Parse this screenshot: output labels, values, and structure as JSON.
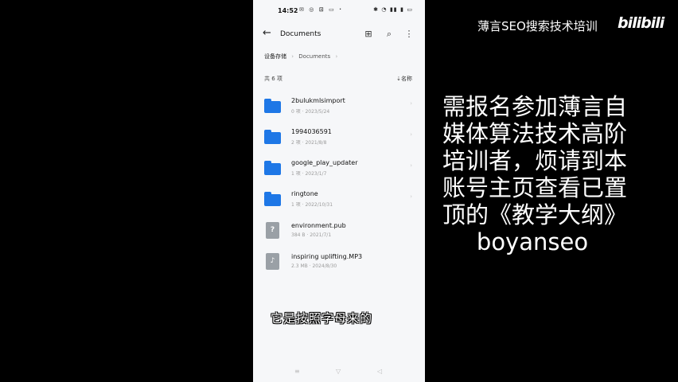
{
  "status": {
    "time": "14:52",
    "left_icons": "✉ ◎ ⊡ ▭ ·",
    "right_icons": "✱ ◔ ▮▮ ▮ ▭"
  },
  "appbar": {
    "title": "Documents"
  },
  "breadcrumb": {
    "root": "设备存储",
    "sep": "›",
    "current": "Documents",
    "tail": "›"
  },
  "list_header": {
    "count": "共 6 项",
    "sort": "⇣名称"
  },
  "files": [
    {
      "name": "2bulukmlsimport",
      "meta": "0 项  ·  2023/5/24",
      "type": "folder"
    },
    {
      "name": "1994036591",
      "meta": "2 项  ·  2021/8/8",
      "type": "folder"
    },
    {
      "name": "google_play_updater",
      "meta": "1 项  ·  2023/1/7",
      "type": "folder"
    },
    {
      "name": "ringtone",
      "meta": "1 项  ·  2022/10/31",
      "type": "folder"
    },
    {
      "name": "environment.pub",
      "meta": "384 B  ·  2021/7/1",
      "type": "file",
      "glyph": "?"
    },
    {
      "name": "inspiring uplifting.MP3",
      "meta": "2.3 MB  ·  2024/8/30",
      "type": "file",
      "glyph": "♪"
    }
  ],
  "subtitle": "它是按照字母来的",
  "nav": {
    "menu": "≡",
    "home": "▽",
    "back": "◁"
  },
  "overlay": {
    "brand": "薄言SEO搜索技术培训",
    "logo": "bilibili",
    "notice_lines": [
      "需报名参加薄言自",
      "媒体算法技术高阶",
      "培训者，烦请到本",
      "账号主页查看已置",
      "顶的《教学大纲》"
    ],
    "handle": "boyanseo"
  },
  "colors": {
    "folder": "#1e77e6",
    "file": "#9aa0a6",
    "phone_bg": "#f6f7f9"
  }
}
